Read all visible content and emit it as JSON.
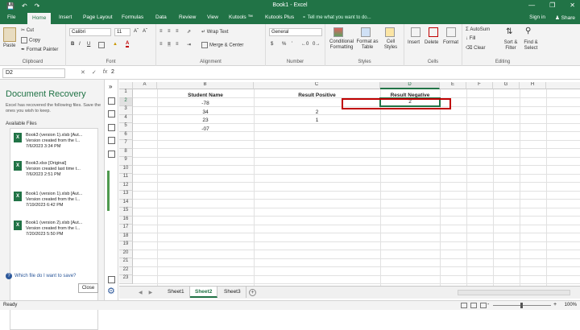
{
  "window": {
    "title": "Book1 - Excel",
    "qat_save": "💾",
    "qat_undo": "↶",
    "qat_redo": "↷",
    "minimize": "—",
    "restore": "❐",
    "close": "✕"
  },
  "tabs": [
    "File",
    "Home",
    "Insert",
    "Page Layout",
    "Formulas",
    "Data",
    "Review",
    "View",
    "Kutools ™",
    "Kutools Plus"
  ],
  "tell_me": "Tell me what you want to do...",
  "sign_in": "Sign in",
  "share": "Share",
  "ribbon": {
    "clipboard": {
      "paste": "Paste",
      "cut": "Cut",
      "copy": "Copy",
      "format_painter": "Format Painter",
      "label": "Clipboard"
    },
    "font": {
      "name": "Calibri",
      "size": "11",
      "bold": "B",
      "italic": "I",
      "underline": "U",
      "label": "Font",
      "font_color": "A"
    },
    "alignment": {
      "wrap_text": "Wrap Text",
      "merge_center": "Merge & Center",
      "label": "Alignment"
    },
    "number": {
      "format": "General",
      "currency": "$",
      "percent": "%",
      "comma": "’",
      "label": "Number"
    },
    "styles": {
      "conditional": "Conditional Formatting",
      "format_as": "Format as Table",
      "cell_styles": "Cell Styles",
      "label": "Styles"
    },
    "cells": {
      "insert": "Insert",
      "delete": "Delete",
      "format": "Format",
      "label": "Cells"
    },
    "editing": {
      "autosum": "AutoSum",
      "fill": "Fill",
      "clear": "Clear",
      "sort": "Sort & Filter",
      "find": "Find & Select",
      "label": "Editing"
    }
  },
  "formula_bar": {
    "name_box": "D2",
    "cancel": "✕",
    "enter": "✓",
    "fx": "fx",
    "value": "2"
  },
  "recovery": {
    "title": "Document Recovery",
    "description": "Excel has recovered the following files. Save the ones you wish to keep.",
    "available_label": "Available Files",
    "files": [
      {
        "name": "Book3 (version 1).xlsb  [Aut...",
        "detail": "Version created from the l...",
        "date": "7/6/2023 3:34 PM"
      },
      {
        "name": "Book3.xlsx  [Original]",
        "detail": "Version created last time t...",
        "date": "7/6/2023 2:51 PM"
      },
      {
        "name": "Book1 (version 1).xlsb  [Aut...",
        "detail": "Version created from the l...",
        "date": "7/19/2023 6:42 PM"
      },
      {
        "name": "Book1 (version 2).xlsb  [Aut...",
        "detail": "Version created from the l...",
        "date": "7/20/2023 5:50 PM"
      }
    ],
    "which_file": "Which file do I want to save?",
    "close": "Close",
    "collapse": "»"
  },
  "grid": {
    "columns": [
      "A",
      "B",
      "C",
      "D",
      "E",
      "F",
      "G",
      "H"
    ],
    "rows": [
      "1",
      "2",
      "3",
      "4",
      "5",
      "6",
      "7",
      "8",
      "9",
      "10",
      "11",
      "12",
      "13",
      "14",
      "15",
      "16",
      "17",
      "18",
      "19",
      "20",
      "21",
      "22",
      "23"
    ],
    "headers": {
      "b": "Student Name",
      "c": "Result Positive",
      "d": "Result Negative"
    },
    "b_values": [
      "-78",
      "34",
      "23",
      "-07"
    ],
    "c_values": [
      "",
      "2",
      "1",
      ""
    ],
    "d_values": [
      "2",
      "",
      "",
      ""
    ],
    "active_cell": "D2"
  },
  "sheets": [
    "Sheet1",
    "Sheet2",
    "Sheet3"
  ],
  "active_sheet": "Sheet2",
  "add_sheet": "+",
  "status": {
    "ready": "Ready",
    "zoom": "100%",
    "zoom_minus": "-",
    "zoom_plus": "+"
  }
}
